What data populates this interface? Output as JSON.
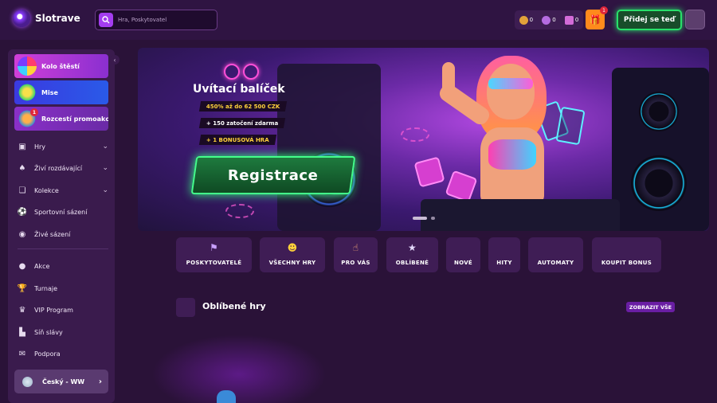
{
  "header": {
    "logo_text": "Slotrave",
    "search_placeholder": "Hra, Poskytovatel",
    "wallet": [
      {
        "icon": "gold-coin-icon",
        "value": "0",
        "color": "#e2a23a"
      },
      {
        "icon": "purple-coin-icon",
        "value": "0",
        "color": "#b46be0"
      },
      {
        "icon": "bonus-bb-icon",
        "value": "0",
        "color": "#d36bd8"
      }
    ],
    "gift_badge": "1",
    "join_label": "Přidej se teď"
  },
  "sidebar": {
    "promos": [
      {
        "label": "Kolo štěstí",
        "bg": "#b02fd6"
      },
      {
        "label": "Mise",
        "bg": "#2a3bd8"
      },
      {
        "label": "Rozcestí promoakcí",
        "bg": "#7a2fb8",
        "badge": "1"
      }
    ],
    "nav_top": [
      {
        "label": "Hry",
        "icon": "games-icon",
        "has_chevron": true
      },
      {
        "label": "Živí rozdávající",
        "icon": "live-dealer-icon",
        "has_chevron": true
      },
      {
        "label": "Kolekce",
        "icon": "collection-icon",
        "has_chevron": true
      },
      {
        "label": "Sportovní sázení",
        "icon": "soccer-ball-icon",
        "has_chevron": false
      },
      {
        "label": "Živé sázení",
        "icon": "live-broadcast-icon",
        "has_chevron": false
      }
    ],
    "nav_bottom": [
      {
        "label": "Akce",
        "icon": "medal-icon"
      },
      {
        "label": "Turnaje",
        "icon": "trophy-icon"
      },
      {
        "label": "VIP Program",
        "icon": "crown-icon"
      },
      {
        "label": "Síň slávy",
        "icon": "podium-icon"
      },
      {
        "label": "Podpora",
        "icon": "chat-support-icon"
      }
    ],
    "language": "Český - WW"
  },
  "banner": {
    "title": "Uvítací balíček",
    "lines": [
      "450% až do 62 500 CZK",
      "+ 150 zatočení zdarma",
      "+ 1 BONUSOVÁ HRA"
    ],
    "line_colors": [
      "#ffd23a",
      "#ffffff",
      "#ffd23a"
    ],
    "cta": "Registrace",
    "slides": 2,
    "active_slide": 1
  },
  "categories": [
    {
      "label": "POSKYTOVATELÉ",
      "icon": "flag-icon"
    },
    {
      "label": "VŠECHNY HRY",
      "icon": "smiley-icon"
    },
    {
      "label": "PRO VÁS",
      "icon": "pointing-hand-icon"
    },
    {
      "label": "OBLÍBENÉ",
      "icon": "star-icon"
    },
    {
      "label": "NOVÉ",
      "icon": ""
    },
    {
      "label": "HITY",
      "icon": ""
    },
    {
      "label": "AUTOMATY",
      "icon": ""
    },
    {
      "label": "KOUPIT BONUS",
      "icon": ""
    }
  ],
  "favorites": {
    "title": "Oblíbené hry",
    "show_all": "ZOBRAZIT VŠE"
  },
  "colors": {
    "background": "#2a1238",
    "accent_green": "#28e06a",
    "accent_purple": "#a43df0",
    "gift_orange": "#ff8a1c"
  }
}
